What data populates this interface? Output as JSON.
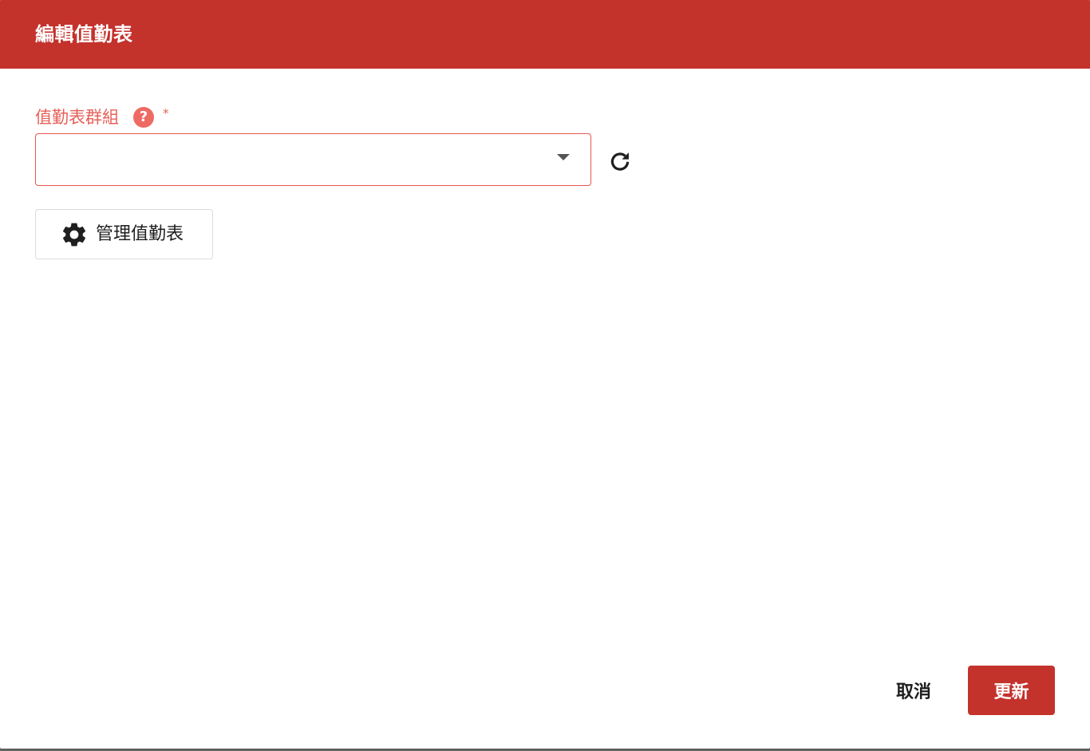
{
  "dialog": {
    "title": "編輯值勤表"
  },
  "form": {
    "group_label": "值勤表群組",
    "help_symbol": "?",
    "required_marker": "*",
    "group_select_value": ""
  },
  "actions": {
    "manage_label": "管理值勤表",
    "cancel_label": "取消",
    "update_label": "更新"
  },
  "icons": {
    "help": "help-icon",
    "caret": "caret-down-icon",
    "refresh": "refresh-icon",
    "settings": "gear-icon"
  },
  "colors": {
    "header_bg": "#c4322c",
    "label_accent": "#e85f58",
    "primary_button": "#c4322c"
  }
}
